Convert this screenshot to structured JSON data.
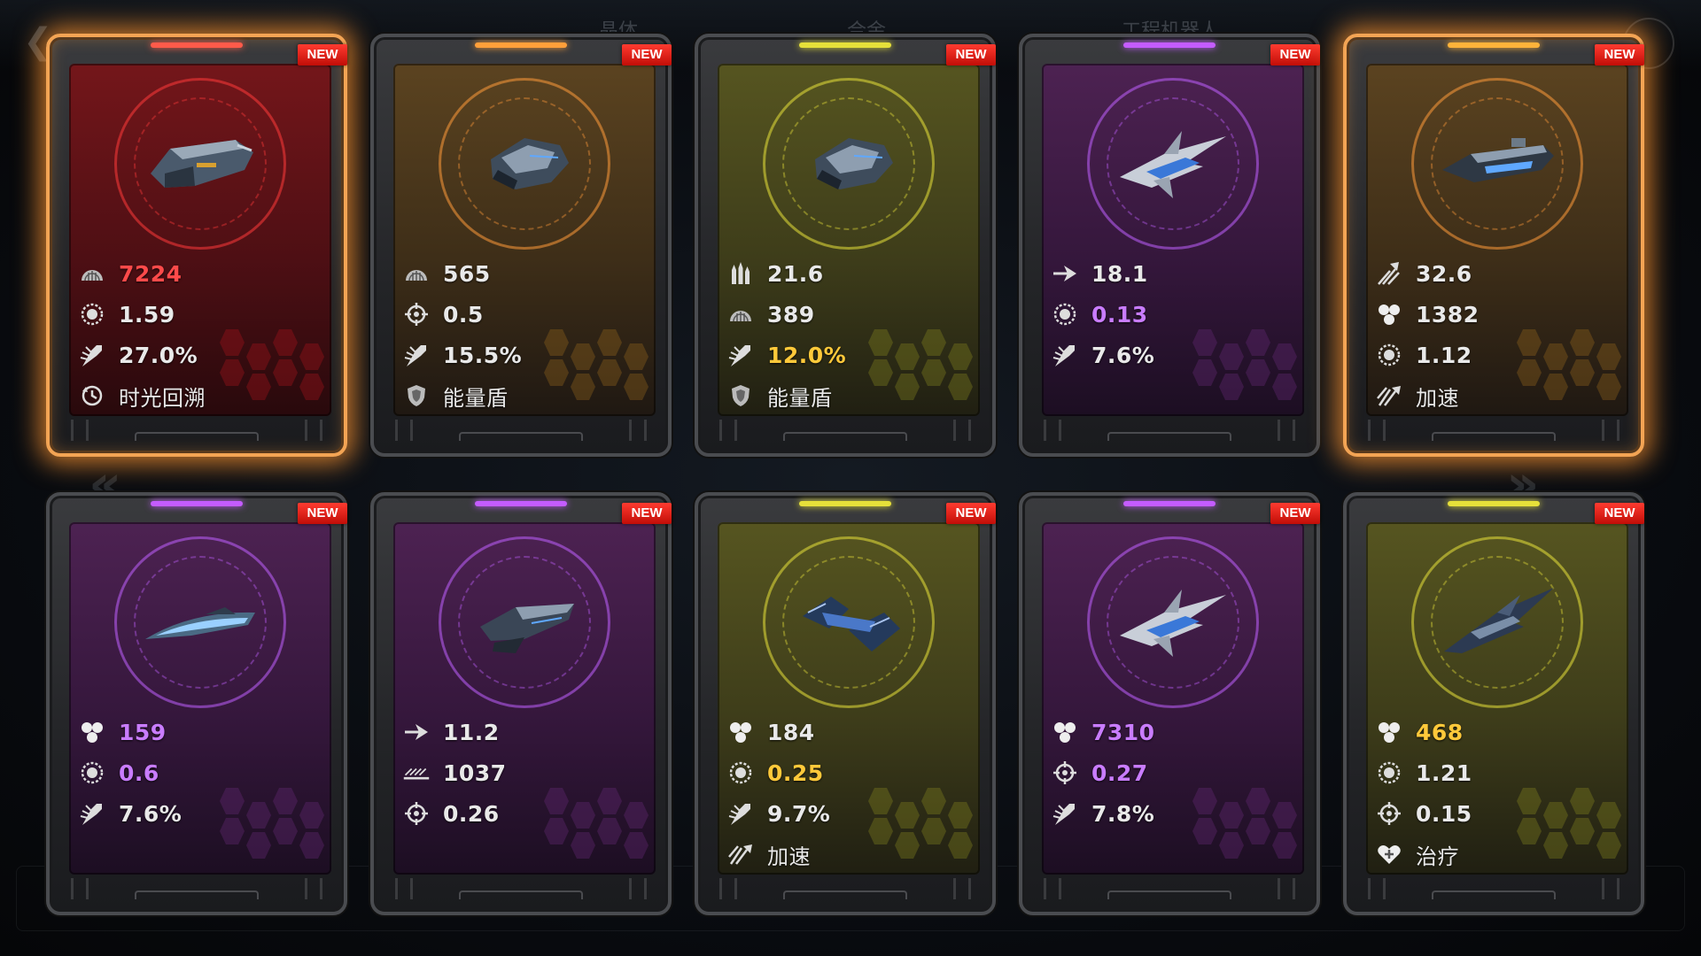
{
  "background": {
    "tabs": [
      "晶体",
      "合金",
      "工程机器人"
    ]
  },
  "badge_text": "NEW",
  "cards": [
    {
      "grade_color": "#ff5a4a",
      "panel": "red",
      "selected": true,
      "ship": "heavy-cruiser",
      "stats": [
        {
          "icon": "armor-icon",
          "value": "7224",
          "color": "red"
        },
        {
          "icon": "rate-icon",
          "value": "1.59",
          "color": "white"
        },
        {
          "icon": "crit-icon",
          "value": "27.0%",
          "color": "white"
        },
        {
          "icon": "rewind-icon",
          "value": "时光回溯",
          "color": "white",
          "skill": true
        }
      ]
    },
    {
      "grade_color": "#ff9f3a",
      "panel": "orange",
      "selected": false,
      "ship": "assault-frigate",
      "stats": [
        {
          "icon": "armor-icon",
          "value": "565",
          "color": "white"
        },
        {
          "icon": "target-icon",
          "value": "0.5",
          "color": "white"
        },
        {
          "icon": "crit-icon",
          "value": "15.5%",
          "color": "white"
        },
        {
          "icon": "shield-icon",
          "value": "能量盾",
          "color": "white",
          "skill": true
        }
      ]
    },
    {
      "grade_color": "#e6e03a",
      "panel": "gold",
      "selected": false,
      "ship": "assault-frigate",
      "stats": [
        {
          "icon": "ammo-icon",
          "value": "21.6",
          "color": "white"
        },
        {
          "icon": "armor-icon",
          "value": "389",
          "color": "white"
        },
        {
          "icon": "crit-icon",
          "value": "12.0%",
          "color": "gold"
        },
        {
          "icon": "shield-icon",
          "value": "能量盾",
          "color": "white",
          "skill": true
        }
      ]
    },
    {
      "grade_color": "#c45cff",
      "panel": "purple",
      "selected": false,
      "ship": "interceptor",
      "stats": [
        {
          "icon": "speed-icon",
          "value": "18.1",
          "color": "white"
        },
        {
          "icon": "rate-icon",
          "value": "0.13",
          "color": "purple"
        },
        {
          "icon": "crit-icon",
          "value": "7.6%",
          "color": "white"
        }
      ]
    },
    {
      "grade_color": "#ffb33a",
      "panel": "orange",
      "selected": true,
      "ship": "battleship",
      "stats": [
        {
          "icon": "burst-icon",
          "value": "32.6",
          "color": "white"
        },
        {
          "icon": "hull-icon",
          "value": "1382",
          "color": "white"
        },
        {
          "icon": "rate-icon",
          "value": "1.12",
          "color": "white"
        },
        {
          "icon": "boost-icon",
          "value": "加速",
          "color": "white",
          "skill": true
        }
      ]
    },
    {
      "grade_color": "#c45cff",
      "panel": "purple",
      "selected": false,
      "ship": "corvette",
      "stats": [
        {
          "icon": "hull-icon",
          "value": "159",
          "color": "purple"
        },
        {
          "icon": "rate-icon",
          "value": "0.6",
          "color": "purple"
        },
        {
          "icon": "crit-icon",
          "value": "7.6%",
          "color": "white"
        }
      ]
    },
    {
      "grade_color": "#c45cff",
      "panel": "purple",
      "selected": false,
      "ship": "destroyer",
      "stats": [
        {
          "icon": "speed-icon",
          "value": "11.2",
          "color": "white"
        },
        {
          "icon": "range-icon",
          "value": "1037",
          "color": "white"
        },
        {
          "icon": "target-icon",
          "value": "0.26",
          "color": "white"
        }
      ]
    },
    {
      "grade_color": "#e6e03a",
      "panel": "gold",
      "selected": false,
      "ship": "carrier",
      "stats": [
        {
          "icon": "hull-icon",
          "value": "184",
          "color": "white"
        },
        {
          "icon": "rate-icon",
          "value": "0.25",
          "color": "gold"
        },
        {
          "icon": "crit-icon",
          "value": "9.7%",
          "color": "white"
        },
        {
          "icon": "boost-icon",
          "value": "加速",
          "color": "white",
          "skill": true
        }
      ]
    },
    {
      "grade_color": "#c45cff",
      "panel": "purple",
      "selected": false,
      "ship": "interceptor",
      "stats": [
        {
          "icon": "hull-icon",
          "value": "7310",
          "color": "purple"
        },
        {
          "icon": "target-icon",
          "value": "0.27",
          "color": "purple"
        },
        {
          "icon": "crit-icon",
          "value": "7.8%",
          "color": "white"
        }
      ]
    },
    {
      "grade_color": "#e6e03a",
      "panel": "gold",
      "selected": false,
      "ship": "stealth-fighter",
      "stats": [
        {
          "icon": "hull-icon",
          "value": "468",
          "color": "gold"
        },
        {
          "icon": "rate-icon",
          "value": "1.21",
          "color": "white"
        },
        {
          "icon": "target-icon",
          "value": "0.15",
          "color": "white"
        },
        {
          "icon": "heal-icon",
          "value": "治疗",
          "color": "white",
          "skill": true
        }
      ]
    }
  ]
}
